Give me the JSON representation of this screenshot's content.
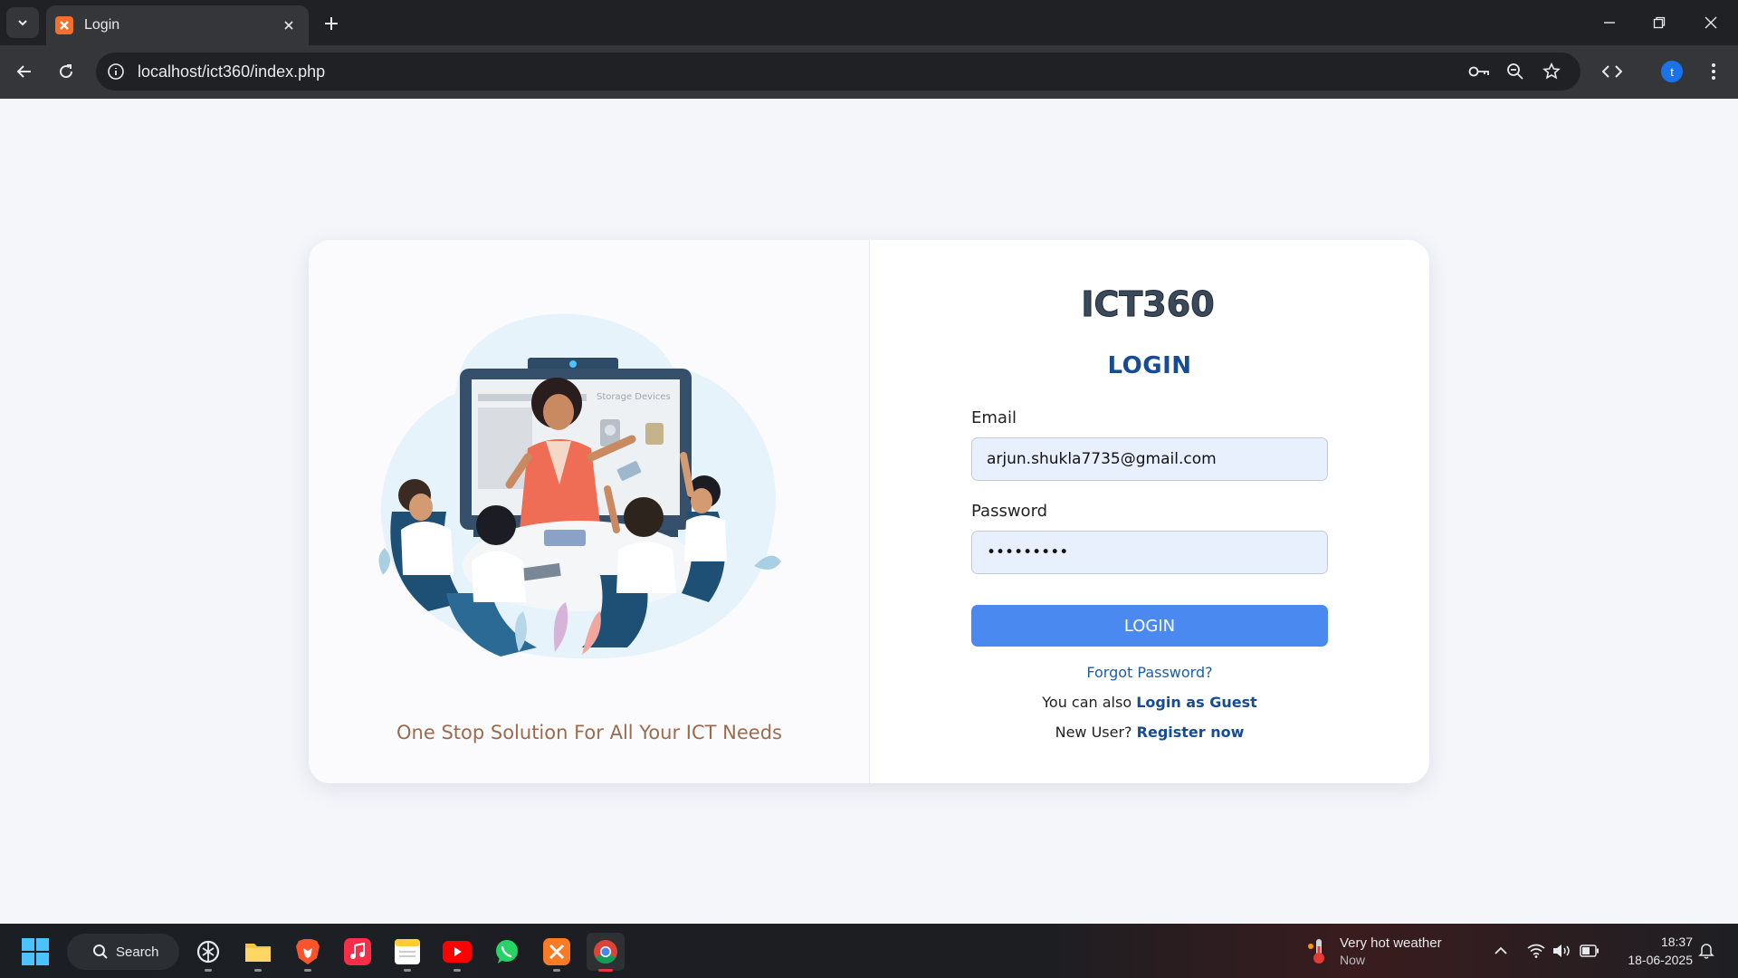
{
  "browser": {
    "tab_title": "Login",
    "url": "localhost/ict360/index.php",
    "profile_initial": "t"
  },
  "page": {
    "logo_text": "ICT360",
    "tagline": "One Stop Solution For All Your ICT Needs",
    "login_title": "LOGIN",
    "email_label": "Email",
    "email_value": "arjun.shukla7735@gmail.com",
    "password_label": "Password",
    "password_value": "•••••••••",
    "login_button": "LOGIN",
    "forgot_password": "Forgot Password?",
    "guest_prefix": "You can also",
    "guest_link": "Login as Guest",
    "register_prefix": "New User?",
    "register_link": "Register now",
    "screen_label": "Storage Devices"
  },
  "taskbar": {
    "search_label": "Search",
    "weather_title": "Very hot weather",
    "weather_sub": "Now",
    "time": "18:37",
    "date": "18-06-2025"
  },
  "colors": {
    "accent": "#4a8af0",
    "title": "#154c95",
    "tagline": "#9c6b4d"
  }
}
